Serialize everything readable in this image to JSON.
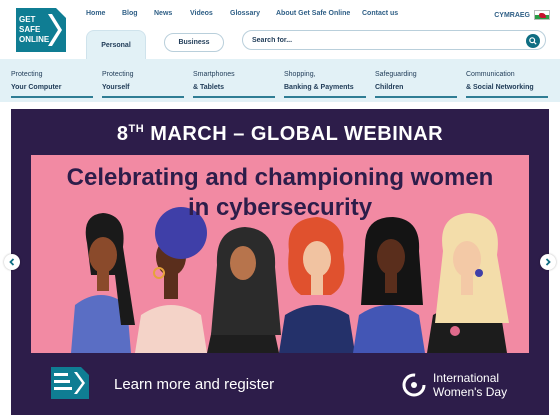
{
  "logo": {
    "line1": "GET",
    "line2": "SAFE",
    "line3": "ONLINE"
  },
  "topnav": {
    "items": [
      "Home",
      "Blog",
      "News",
      "Videos",
      "Glossary",
      "About Get Safe Online",
      "Contact us"
    ],
    "language": "CYMRAEG"
  },
  "tabs": {
    "personal": "Personal",
    "business": "Business"
  },
  "search": {
    "placeholder": "Search for..."
  },
  "categories": [
    {
      "line1": "Protecting",
      "line2": "Your Computer"
    },
    {
      "line1": "Protecting",
      "line2": "Yourself"
    },
    {
      "line1": "Smartphones",
      "line2": "& Tablets"
    },
    {
      "line1": "Shopping,",
      "line2": "Banking & Payments"
    },
    {
      "line1": "Safeguarding",
      "line2": "Children"
    },
    {
      "line1": "Communication",
      "line2": "& Social Networking"
    }
  ],
  "hero": {
    "title_day": "8",
    "title_suffix": "TH",
    "title_rest": " MARCH – GLOBAL WEBINAR",
    "headline_line1": "Celebrating and championing women",
    "headline_line2": "in cybersecurity",
    "cta": "Learn more and register",
    "badge_line1": "International",
    "badge_line2": "Women's Day"
  },
  "colors": {
    "brand_teal": "#0f6e83",
    "hero_bg": "#2d1d4a",
    "hero_pink": "#f28aa3",
    "category_bg": "#e2f1f6"
  },
  "icons": [
    "get-safe-online-logo",
    "search-icon",
    "wales-flag-icon",
    "chevron-left-icon",
    "chevron-right-icon",
    "iwd-symbol-icon"
  ]
}
